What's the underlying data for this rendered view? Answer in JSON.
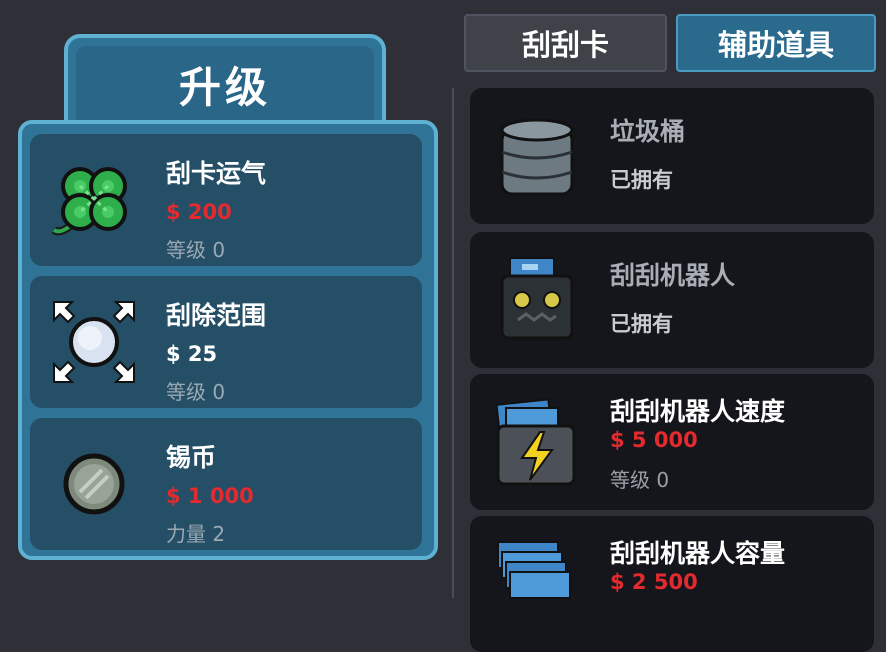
{
  "upgrade_panel": {
    "title": "升级",
    "items": [
      {
        "name": "刮卡运气",
        "price": "$ 200",
        "level": "等级 0",
        "icon": "clover-icon"
      },
      {
        "name": "刮除范围",
        "price": "$ 25",
        "level": "等级 0",
        "icon": "scratch-range-icon"
      },
      {
        "name": "锡币",
        "price": "$ 1 000",
        "level": "力量 2",
        "icon": "tin-coin-icon"
      }
    ]
  },
  "tabs": {
    "scratch_cards": "刮刮卡",
    "tools": "辅助道具"
  },
  "tools": [
    {
      "name": "垃圾桶",
      "status": "已拥有",
      "icon": "trash-can-icon"
    },
    {
      "name": "刮刮机器人",
      "status": "已拥有",
      "icon": "robot-icon"
    },
    {
      "name": "刮刮机器人速度",
      "price": "$ 5 000",
      "level": "等级 0",
      "icon": "lightning-icon"
    },
    {
      "name": "刮刮机器人容量",
      "price": "$ 2 500",
      "icon": "card-stack-icon"
    }
  ],
  "colors": {
    "background": "#2e2f37",
    "panel_blue": "#2f7396",
    "card_blue": "#254f67",
    "price_red": "#e22a2f",
    "tool_card": "#15161b"
  }
}
